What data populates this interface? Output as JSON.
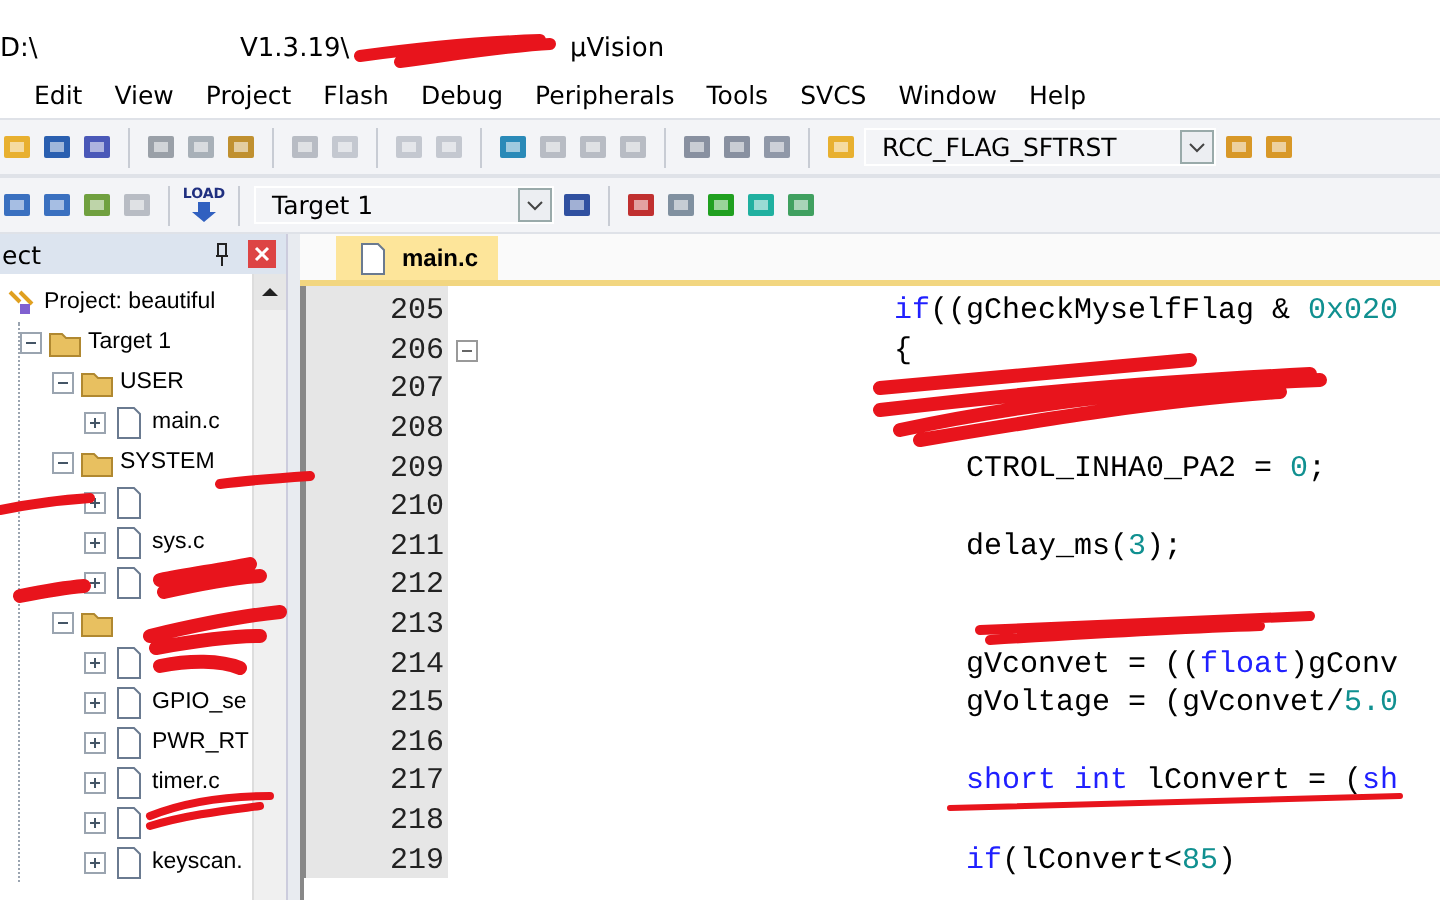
{
  "window": {
    "title_parts": [
      "D:\\",
      "V1.3.19\\",
      "µVision"
    ]
  },
  "menu": [
    "Edit",
    "View",
    "Project",
    "Flash",
    "Debug",
    "Peripherals",
    "Tools",
    "SVCS",
    "Window",
    "Help"
  ],
  "toolbar": {
    "find_combo": "RCC_FLAG_SFTRST",
    "target_combo": "Target 1",
    "load_label": "LOAD"
  },
  "project_panel": {
    "title": "ect",
    "tree": [
      {
        "label": "Project: beautiful",
        "kind": "project",
        "expanded": true,
        "children": [
          {
            "label": "Target 1",
            "kind": "target",
            "expanded": true,
            "children": [
              {
                "label": "USER",
                "kind": "group",
                "expanded": true,
                "children": [
                  {
                    "label": "main.c",
                    "kind": "file",
                    "expanded": false
                  }
                ]
              },
              {
                "label": "SYSTEM",
                "kind": "group",
                "expanded": true,
                "children": [
                  {
                    "kind": "file",
                    "expanded": false
                  },
                  {
                    "label": "sys.c",
                    "kind": "file",
                    "expanded": false
                  },
                  {
                    "kind": "file",
                    "expanded": false
                  }
                ]
              },
              {
                "kind": "group",
                "expanded": true,
                "children": [
                  {
                    "kind": "file",
                    "expanded": false
                  },
                  {
                    "label": "GPIO_se",
                    "kind": "file",
                    "expanded": false
                  },
                  {
                    "label": "PWR_RT",
                    "kind": "file",
                    "expanded": false
                  },
                  {
                    "label": "timer.c",
                    "kind": "file",
                    "expanded": false
                  },
                  {
                    "kind": "file",
                    "expanded": false
                  },
                  {
                    "label": "keyscan.",
                    "kind": "file",
                    "expanded": false
                  }
                ]
              }
            ]
          }
        ]
      }
    ]
  },
  "editor": {
    "tabs": [
      {
        "label": "main.c",
        "selected": true
      }
    ],
    "lines": [
      {
        "number": "205",
        "kind": "outer",
        "fold": false,
        "tokens": [
          {
            "kind": "keyword",
            "text": "if"
          },
          {
            "kind": "plain",
            "text": "((gCheckMyselfFlag & "
          },
          {
            "kind": "number",
            "text": "0x020"
          }
        ]
      },
      {
        "number": "206",
        "kind": "outer",
        "fold": true,
        "tokens": [
          {
            "kind": "plain",
            "text": "{"
          }
        ]
      },
      {
        "number": "207",
        "kind": "inner",
        "fold": false
      },
      {
        "number": "208",
        "kind": "inner",
        "fold": false
      },
      {
        "number": "209",
        "kind": "inner",
        "fold": false,
        "tokens": [
          {
            "kind": "plain",
            "text": "CTROL_INHA0_PA2 = "
          },
          {
            "kind": "number",
            "text": "0"
          },
          {
            "kind": "plain",
            "text": ";"
          }
        ]
      },
      {
        "number": "210",
        "kind": "inner",
        "fold": false
      },
      {
        "number": "211",
        "kind": "inner",
        "fold": false,
        "tokens": [
          {
            "kind": "plain",
            "text": "delay_ms("
          },
          {
            "kind": "number",
            "text": "3"
          },
          {
            "kind": "plain",
            "text": ");"
          }
        ]
      },
      {
        "number": "212",
        "kind": "inner",
        "fold": false
      },
      {
        "number": "213",
        "kind": "inner",
        "fold": false
      },
      {
        "number": "214",
        "kind": "inner",
        "fold": false,
        "tokens": [
          {
            "kind": "plain",
            "text": "gVconvet = (("
          },
          {
            "kind": "keyword",
            "text": "float"
          },
          {
            "kind": "plain",
            "text": ")gConv"
          }
        ]
      },
      {
        "number": "215",
        "kind": "inner",
        "fold": false,
        "tokens": [
          {
            "kind": "plain",
            "text": "gVoltage = (gVconvet/"
          },
          {
            "kind": "number",
            "text": "5.0"
          }
        ]
      },
      {
        "number": "216",
        "kind": "inner",
        "fold": false
      },
      {
        "number": "217",
        "kind": "inner",
        "fold": false,
        "tokens": [
          {
            "kind": "keyword",
            "text": "short int"
          },
          {
            "kind": "plain",
            "text": " lConvert = ("
          },
          {
            "kind": "keyword",
            "text": "sh"
          }
        ]
      },
      {
        "number": "218",
        "kind": "inner",
        "fold": false
      },
      {
        "number": "219",
        "kind": "inner",
        "fold": false,
        "tokens": [
          {
            "kind": "keyword",
            "text": "if"
          },
          {
            "kind": "plain",
            "text": "(lConvert<"
          },
          {
            "kind": "number",
            "text": "85"
          },
          {
            "kind": "plain",
            "text": ")"
          }
        ]
      }
    ]
  }
}
